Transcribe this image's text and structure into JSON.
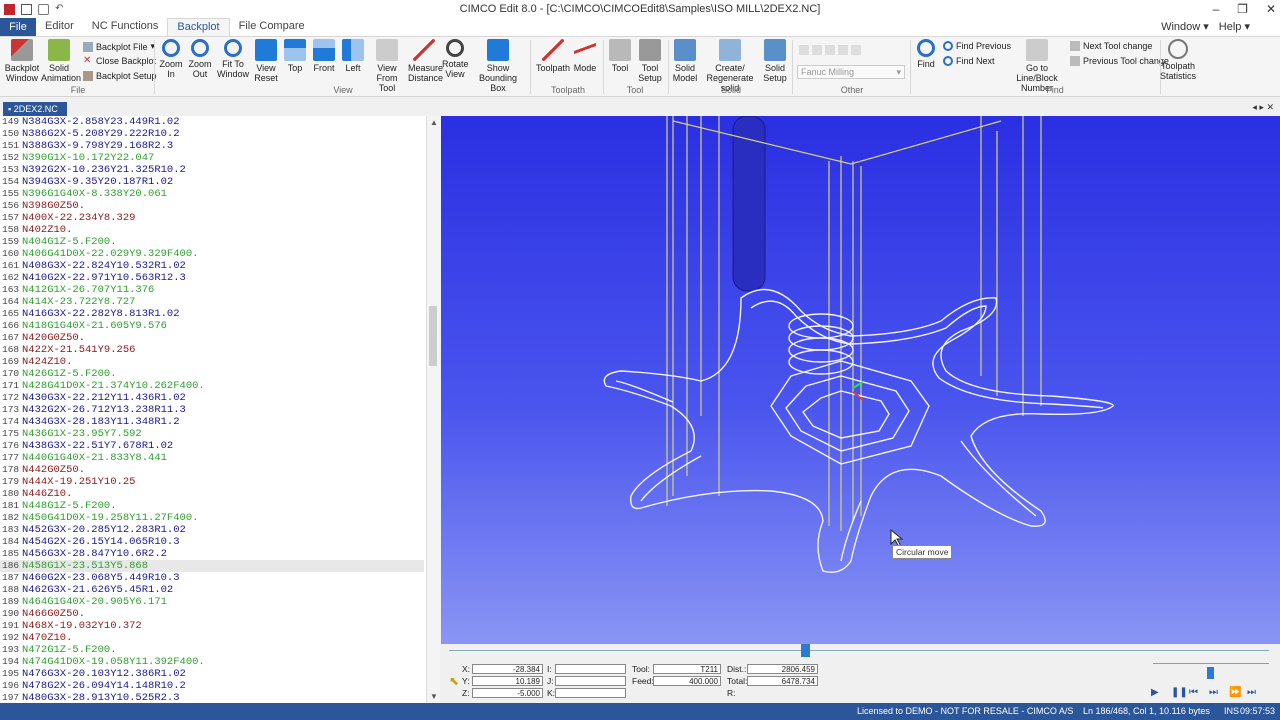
{
  "window": {
    "title": "CIMCO Edit 8.0 - [C:\\CIMCO\\CIMCOEdit8\\Samples\\ISO MILL\\2DEX2.NC]"
  },
  "menu": {
    "tabs": [
      "File",
      "Editor",
      "NC Functions",
      "Backplot",
      "File Compare"
    ],
    "window_label": "Window",
    "help_label": "Help"
  },
  "ribbon": {
    "backplot_window": "Backplot Window",
    "solid_animation": "Solid Animation",
    "backplot_file": "Backplot File",
    "close_backplot": "Close Backplot",
    "backplot_setup": "Backplot Setup",
    "zoom_in": "Zoom In",
    "zoom_out": "Zoom Out",
    "fit_to_window": "Fit To Window",
    "view_reset": "View Reset",
    "top": "Top",
    "front": "Front",
    "left": "Left",
    "view_from_tool": "View From Tool",
    "measure_distance": "Measure Distance",
    "rotate_view": "Rotate View",
    "show_bounding_box": "Show Bounding Box",
    "toolpath": "Toolpath",
    "mode": "Mode",
    "tool": "Tool",
    "tool_setup": "Tool Setup",
    "solid_model": "Solid Model",
    "create_regenerate_solid": "Create/ Regenerate solid",
    "solid_setup": "Solid Setup",
    "machine_combo": "Fanuc Milling",
    "find": "Find",
    "find_previous": "Find Previous",
    "find_next": "Find Next",
    "go_to_line": "Go to Line/Block Number",
    "next_tool_change": "Next Tool change",
    "previous_tool_change": "Previous Tool change",
    "toolpath_statistics": "Toolpath Statistics",
    "groups": {
      "file": "File",
      "view": "View",
      "toolpath": "Toolpath",
      "tool": "Tool",
      "solid": "Solid",
      "other": "Other",
      "find": "Find"
    }
  },
  "document_tab": "2DEX2.NC",
  "editor": {
    "lines": [
      {
        "n": "149",
        "code": "N384G3X-2.858Y23.449R1.02",
        "c": "blue"
      },
      {
        "n": "150",
        "code": "N386G2X-5.208Y29.222R10.2",
        "c": "blue"
      },
      {
        "n": "151",
        "code": "N388G3X-9.798Y29.168R2.3",
        "c": "blue"
      },
      {
        "n": "152",
        "code": "N390G1X-10.172Y22.047",
        "c": "green"
      },
      {
        "n": "153",
        "code": "N392G2X-10.236Y21.325R10.2",
        "c": "blue"
      },
      {
        "n": "154",
        "code": "N394G3X-9.35Y20.187R1.02",
        "c": "blue"
      },
      {
        "n": "155",
        "code": "N396G1G40X-8.338Y20.061",
        "c": "green"
      },
      {
        "n": "156",
        "code": "N398G0Z50.",
        "c": "red"
      },
      {
        "n": "157",
        "code": "N400X-22.234Y8.329",
        "c": "red"
      },
      {
        "n": "158",
        "code": "N402Z10.",
        "c": "red"
      },
      {
        "n": "159",
        "code": "N404G1Z-5.F200.",
        "c": "green"
      },
      {
        "n": "160",
        "code": "N406G41D0X-22.029Y9.329F400.",
        "c": "green"
      },
      {
        "n": "161",
        "code": "N408G3X-22.824Y10.532R1.02",
        "c": "blue"
      },
      {
        "n": "162",
        "code": "N410G2X-22.971Y10.563R12.3",
        "c": "blue"
      },
      {
        "n": "163",
        "code": "N412G1X-26.707Y11.376",
        "c": "green"
      },
      {
        "n": "164",
        "code": "N414X-23.722Y8.727",
        "c": "green"
      },
      {
        "n": "165",
        "code": "N416G3X-22.282Y8.813R1.02",
        "c": "blue"
      },
      {
        "n": "166",
        "code": "N418G1G40X-21.605Y9.576",
        "c": "green"
      },
      {
        "n": "167",
        "code": "N420G0Z50.",
        "c": "red"
      },
      {
        "n": "168",
        "code": "N422X-21.541Y9.256",
        "c": "red"
      },
      {
        "n": "169",
        "code": "N424Z10.",
        "c": "red"
      },
      {
        "n": "170",
        "code": "N426G1Z-5.F200.",
        "c": "green"
      },
      {
        "n": "171",
        "code": "N428G41D0X-21.374Y10.262F400.",
        "c": "green"
      },
      {
        "n": "172",
        "code": "N430G3X-22.212Y11.436R1.02",
        "c": "blue"
      },
      {
        "n": "173",
        "code": "N432G2X-26.712Y13.238R11.3",
        "c": "blue"
      },
      {
        "n": "174",
        "code": "N434G3X-28.183Y11.348R1.2",
        "c": "blue"
      },
      {
        "n": "175",
        "code": "N436G1X-23.95Y7.592",
        "c": "green"
      },
      {
        "n": "176",
        "code": "N438G3X-22.51Y7.678R1.02",
        "c": "blue"
      },
      {
        "n": "177",
        "code": "N440G1G40X-21.833Y8.441",
        "c": "green"
      },
      {
        "n": "178",
        "code": "N442G0Z50.",
        "c": "red"
      },
      {
        "n": "179",
        "code": "N444X-19.251Y10.25",
        "c": "red"
      },
      {
        "n": "180",
        "code": "N446Z10.",
        "c": "red"
      },
      {
        "n": "181",
        "code": "N448G1Z-5.F200.",
        "c": "green"
      },
      {
        "n": "182",
        "code": "N450G41D0X-19.258Y11.27F400.",
        "c": "green"
      },
      {
        "n": "183",
        "code": "N452G3X-20.285Y12.283R1.02",
        "c": "blue"
      },
      {
        "n": "184",
        "code": "N454G2X-26.15Y14.065R10.3",
        "c": "blue"
      },
      {
        "n": "185",
        "code": "N456G3X-28.847Y10.6R2.2",
        "c": "blue"
      },
      {
        "n": "186",
        "code": "N458G1X-23.513Y5.868",
        "c": "green",
        "sel": true
      },
      {
        "n": "187",
        "code": "N460G2X-23.068Y5.449R10.3",
        "c": "blue"
      },
      {
        "n": "188",
        "code": "N462G3X-21.626Y5.45R1.02",
        "c": "blue"
      },
      {
        "n": "189",
        "code": "N464G1G40X-20.905Y6.171",
        "c": "green"
      },
      {
        "n": "190",
        "code": "N466G0Z50.",
        "c": "red"
      },
      {
        "n": "191",
        "code": "N468X-19.032Y10.372",
        "c": "red"
      },
      {
        "n": "192",
        "code": "N470Z10.",
        "c": "red"
      },
      {
        "n": "193",
        "code": "N472G1Z-5.F200.",
        "c": "green"
      },
      {
        "n": "194",
        "code": "N474G41D0X-19.058Y11.392F400.",
        "c": "green"
      },
      {
        "n": "195",
        "code": "N476G3X-20.103Y12.386R1.02",
        "c": "blue"
      },
      {
        "n": "196",
        "code": "N478G2X-26.094Y14.148R10.2",
        "c": "blue"
      },
      {
        "n": "197",
        "code": "N480G3X-28.913Y10.525R2.3",
        "c": "blue"
      }
    ],
    "colors": {
      "blue": "#1a1a8c",
      "green": "#2ea02e",
      "red": "#8b1a1a"
    }
  },
  "viewport": {
    "tooltip": "Circular move"
  },
  "readout": {
    "x_label": "X:",
    "x": "-28.384",
    "y_label": "Y:",
    "y": "10.189",
    "z_label": "Z:",
    "z": "-5.000",
    "i_label": "I:",
    "j_label": "J:",
    "k_label": "K:",
    "tool_label": "Tool:",
    "tool": "T211",
    "feed_label": "Feed:",
    "feed": "400.000",
    "dist_label": "Dist.:",
    "dist": "2806.459",
    "total_label": "Total:",
    "total": "6478.734",
    "r_label": "R:"
  },
  "status": {
    "license": "Licensed to DEMO - NOT FOR RESALE - CIMCO A/S",
    "position": "Ln 186/468, Col 1, 10.116 bytes",
    "mode": "INS",
    "time": "09:57:53"
  }
}
